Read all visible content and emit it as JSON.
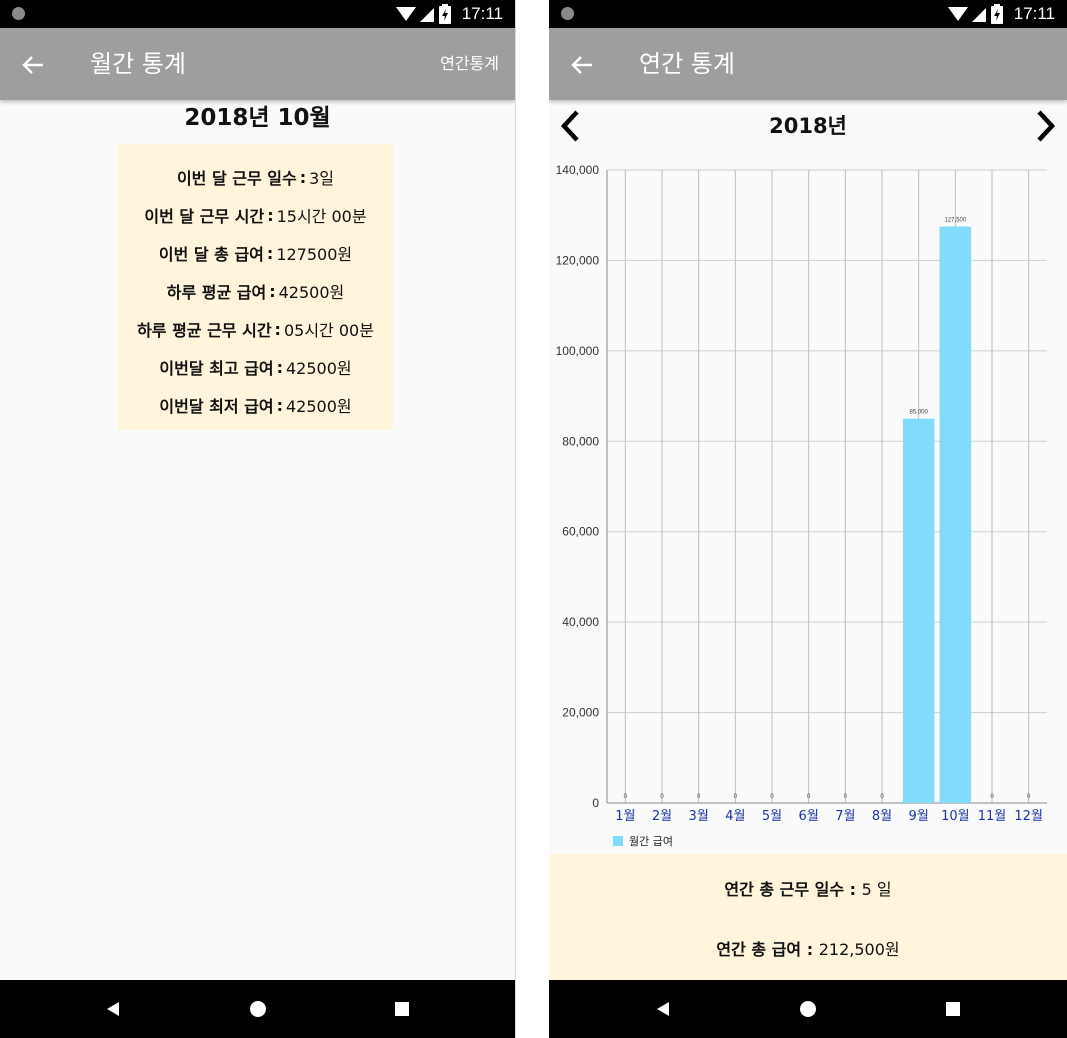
{
  "colors": {
    "app_bar": "#9e9e9e",
    "status_bar": "#000000",
    "card_bg": "#fff5dd",
    "bar_fill": "#80dcfa",
    "month_label": "#1c34a8"
  },
  "status_bar": {
    "time": "17:11",
    "icons": [
      "wifi-icon",
      "signal-icon",
      "battery-charging-icon"
    ]
  },
  "monthly_screen": {
    "title": "월간 통계",
    "action_label": "연간통계",
    "month_title": "2018년 10월",
    "stats": [
      {
        "label": "이번 달 근무 일수",
        "value": "3일"
      },
      {
        "label": "이번 달 근무 시간",
        "value": "15시간 00분"
      },
      {
        "label": "이번 달 총 급여",
        "value": "127500원"
      },
      {
        "label": "하루 평균 급여",
        "value": "42500원"
      },
      {
        "label": "하루 평균 근무 시간",
        "value": "05시간 00분"
      },
      {
        "label": "이번달 최고 급여",
        "value": "42500원"
      },
      {
        "label": "이번달 최저 급여",
        "value": "42500원"
      }
    ]
  },
  "yearly_screen": {
    "title": "연간 통계",
    "year_title": "2018년",
    "summary": [
      {
        "label": "연간 총 근무 일수",
        "value": "5 일"
      },
      {
        "label": "연간 총 급여",
        "value": "212,500원"
      }
    ]
  },
  "chart_data": {
    "type": "bar",
    "categories": [
      "1월",
      "2월",
      "3월",
      "4월",
      "5월",
      "6월",
      "7월",
      "8월",
      "9월",
      "10월",
      "11월",
      "12월"
    ],
    "series": [
      {
        "name": "월간 급여",
        "values": [
          0,
          0,
          0,
          0,
          0,
          0,
          0,
          0,
          85000,
          127500,
          0,
          0
        ]
      }
    ],
    "value_labels": [
      "0",
      "0",
      "0",
      "0",
      "0",
      "0",
      "0",
      "0",
      "85,000",
      "127,500",
      "0",
      "0"
    ],
    "ylim": [
      0,
      140000
    ],
    "y_ticks": [
      0,
      20000,
      40000,
      60000,
      80000,
      100000,
      120000,
      140000
    ],
    "y_tick_labels": [
      "0",
      "20,000",
      "40,000",
      "60,000",
      "80,000",
      "100,000",
      "120,000",
      "140,000"
    ],
    "grid": true,
    "legend": "bottom-left"
  }
}
